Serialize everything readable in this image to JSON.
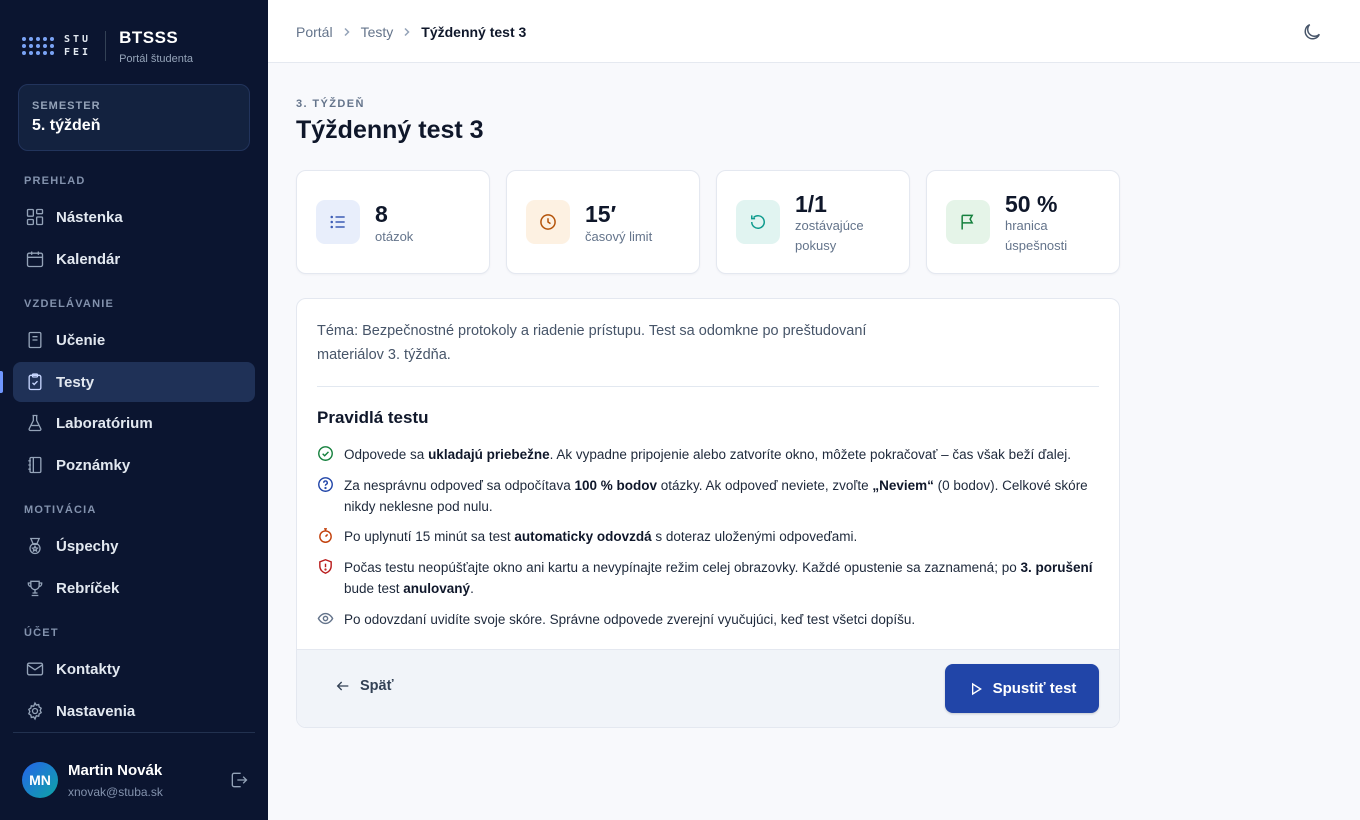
{
  "app": {
    "logo_line1": "STU",
    "logo_line2": "FEI",
    "name": "BTSSS",
    "subtitle": "Portál študenta"
  },
  "semester": {
    "label": "SEMESTER",
    "value": "5. týždeň"
  },
  "nav": {
    "sections": [
      "PREHĽAD",
      "VZDELÁVANIE",
      "MOTIVÁCIA",
      "ÚČET"
    ],
    "items": [
      {
        "label": "Nástenka",
        "icon": "dashboard-icon"
      },
      {
        "label": "Kalendár",
        "icon": "calendar-icon"
      },
      {
        "label": "Učenie",
        "icon": "book-icon"
      },
      {
        "label": "Testy",
        "icon": "clipboard-check-icon",
        "active": true
      },
      {
        "label": "Laboratórium",
        "icon": "flask-icon"
      },
      {
        "label": "Poznámky",
        "icon": "notebook-icon"
      },
      {
        "label": "Úspechy",
        "icon": "medal-icon"
      },
      {
        "label": "Rebríček",
        "icon": "trophy-icon"
      },
      {
        "label": "Kontakty",
        "icon": "mail-icon"
      },
      {
        "label": "Nastavenia",
        "icon": "gear-icon"
      }
    ]
  },
  "user": {
    "initials": "MN",
    "name": "Martin Novák",
    "email": "xnovak@stuba.sk"
  },
  "breadcrumb": [
    "Portál",
    "Testy",
    "Týždenný test 3"
  ],
  "page": {
    "eyebrow": "3. TÝŽDEŇ",
    "title": "Týždenný test 3"
  },
  "stats": [
    {
      "value": "8",
      "label": "otázok",
      "icon": "list-icon",
      "color": "#3b5bb5",
      "bg": "#e8eefb"
    },
    {
      "value": "15′",
      "label": "časový limit",
      "icon": "clock-icon",
      "color": "#b45309",
      "bg": "#fdf1e2"
    },
    {
      "value": "1/1",
      "label": "zostávajúce pokusy",
      "icon": "retry-icon",
      "color": "#0f9b8e",
      "bg": "#e1f4f1"
    },
    {
      "value": "50 %",
      "label": "hranica úspešnosti",
      "icon": "flag-icon",
      "color": "#15803d",
      "bg": "#e5f4e8"
    }
  ],
  "intro": "Téma: Bezpečnostné protokoly a riadenie prístupu. Test sa odomkne po preštudovaní materiálov 3. týždňa.",
  "rules": {
    "title": "Pravidlá testu",
    "items": [
      {
        "icon": "check-circle-icon",
        "color": "#15803d",
        "parts": [
          "Odpovede sa ",
          "ukladajú priebežne",
          ". Ak vypadne pripojenie alebo zatvoríte okno, môžete pokračovať – čas však beží ďalej."
        ]
      },
      {
        "icon": "question-circle-icon",
        "color": "#2145a8",
        "parts": [
          "Za nesprávnu odpoveď sa odpočítava ",
          "100 % bodov",
          " otázky. Ak odpoveď neviete, zvoľte ",
          "„Neviem“",
          " (0 bodov). Celkové skóre nikdy neklesne pod nulu."
        ]
      },
      {
        "icon": "stopwatch-icon",
        "color": "#c2410c",
        "parts": [
          "Po uplynutí 15 minút sa test ",
          "automaticky odovzdá",
          " s doteraz uloženými odpoveďami."
        ]
      },
      {
        "icon": "shield-alert-icon",
        "color": "#b91c1c",
        "parts": [
          "Počas testu neopúšťajte okno ani kartu a nevypínajte režim celej obrazovky. Každé opustenie sa zaznamená; po ",
          "3. porušení",
          " bude test ",
          "anulovaný",
          "."
        ]
      },
      {
        "icon": "eye-icon",
        "color": "#64748b",
        "parts": [
          "Po odovzdaní uvidíte svoje skóre. Správne odpovede zverejní vyučujúci, keď test všetci dopíšu."
        ]
      }
    ]
  },
  "actions": {
    "back": "Späť",
    "start": "Spustiť test"
  },
  "colors": {
    "sidebar": "#0b1530",
    "accent": "#2145a8",
    "active_nav": "#1f3157"
  }
}
